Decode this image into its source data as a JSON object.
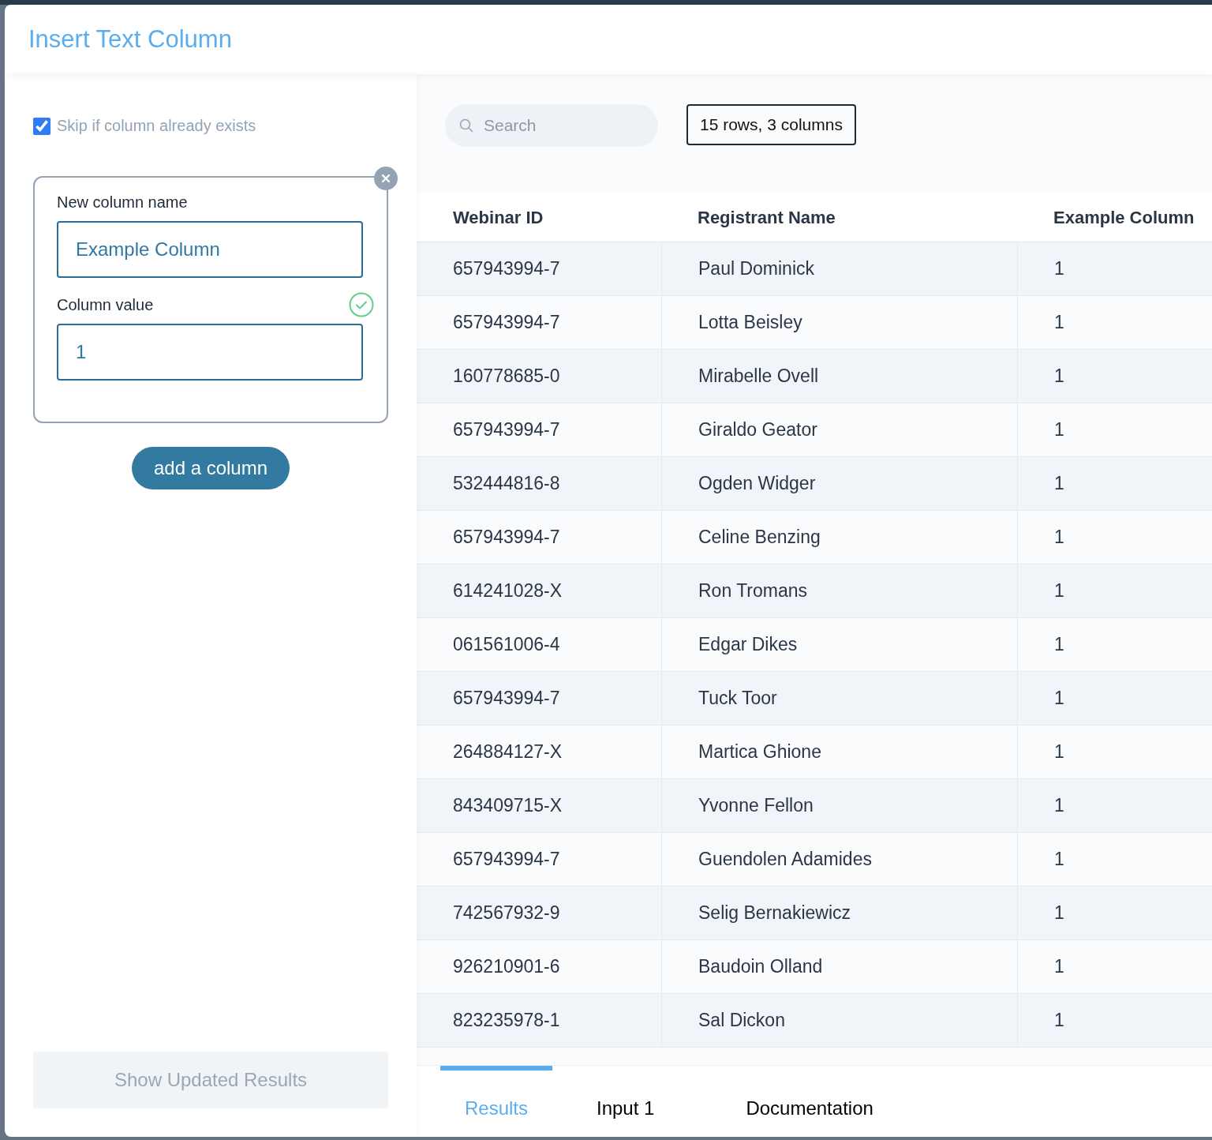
{
  "window": {
    "title": "Insert Text Column"
  },
  "options": {
    "skip_if_exists": {
      "label": "Skip if column already exists",
      "checked": true
    }
  },
  "column_card": {
    "name_label": "New column name",
    "name_value": "Example Column",
    "value_label": "Column value",
    "value": "1",
    "valid": true
  },
  "add_button": "add a column",
  "show_button": {
    "label": "Show Updated Results",
    "disabled": true
  },
  "search": {
    "placeholder": "Search"
  },
  "summary": "15 rows, 3 columns",
  "table": {
    "columns": [
      "Webinar ID",
      "Registrant Name",
      "Example Column"
    ],
    "rows": [
      [
        "657943994-7",
        "Paul Dominick",
        "1"
      ],
      [
        "657943994-7",
        "Lotta Beisley",
        "1"
      ],
      [
        "160778685-0",
        "Mirabelle Ovell",
        "1"
      ],
      [
        "657943994-7",
        "Giraldo Geator",
        "1"
      ],
      [
        "532444816-8",
        "Ogden Widger",
        "1"
      ],
      [
        "657943994-7",
        "Celine Benzing",
        "1"
      ],
      [
        "614241028-X",
        "Ron Tromans",
        "1"
      ],
      [
        "061561006-4",
        "Edgar Dikes",
        "1"
      ],
      [
        "657943994-7",
        "Tuck Toor",
        "1"
      ],
      [
        "264884127-X",
        "Martica Ghione",
        "1"
      ],
      [
        "843409715-X",
        "Yvonne Fellon",
        "1"
      ],
      [
        "657943994-7",
        "Guendolen Adamides",
        "1"
      ],
      [
        "742567932-9",
        "Selig Bernakiewicz",
        "1"
      ],
      [
        "926210901-6",
        "Baudoin Olland",
        "1"
      ],
      [
        "823235978-1",
        "Sal Dickon",
        "1"
      ]
    ]
  },
  "tabs": [
    {
      "label": "Results",
      "selected": true
    },
    {
      "label": "Input 1",
      "selected": false
    },
    {
      "label": "Documentation",
      "selected": false
    }
  ]
}
